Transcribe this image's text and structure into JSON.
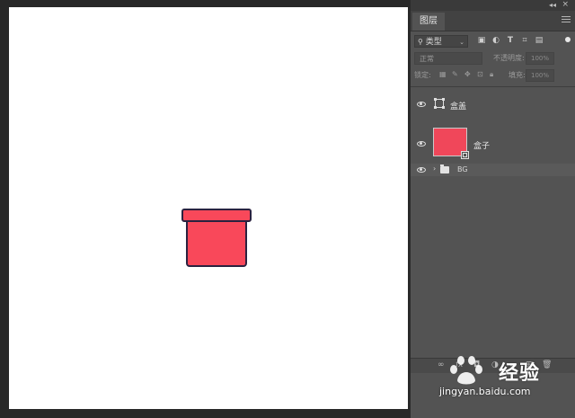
{
  "app": {
    "panel_tab": "图层",
    "panel_collapse_glyph": "◂◂",
    "panel_close_glyph": "×"
  },
  "filter": {
    "kind_label": "类型",
    "chevron": "⌄",
    "icons": [
      "image-filter-icon",
      "adjustment-filter-icon",
      "type-filter-icon",
      "shape-filter-icon",
      "smart-object-filter-icon"
    ]
  },
  "blend": {
    "mode": "正常",
    "opacity_label": "不透明度:",
    "opacity_value": "100%"
  },
  "lock": {
    "label": "锁定:",
    "fill_label": "填充:",
    "fill_value": "100%"
  },
  "layers": [
    {
      "name": "盒盖",
      "visible": true,
      "kind": "smart-object"
    },
    {
      "name": "盒子",
      "visible": true,
      "kind": "smart-object",
      "thumb_color": "#f0475a"
    },
    {
      "name": "BG",
      "visible": true,
      "kind": "group",
      "collapsed": true
    }
  ],
  "canvas": {
    "background": "#ffffff",
    "box_fill": "#f9485a",
    "box_stroke": "#2b2240"
  },
  "watermark": {
    "text": "经验",
    "url": "jingyan.baidu.com"
  }
}
